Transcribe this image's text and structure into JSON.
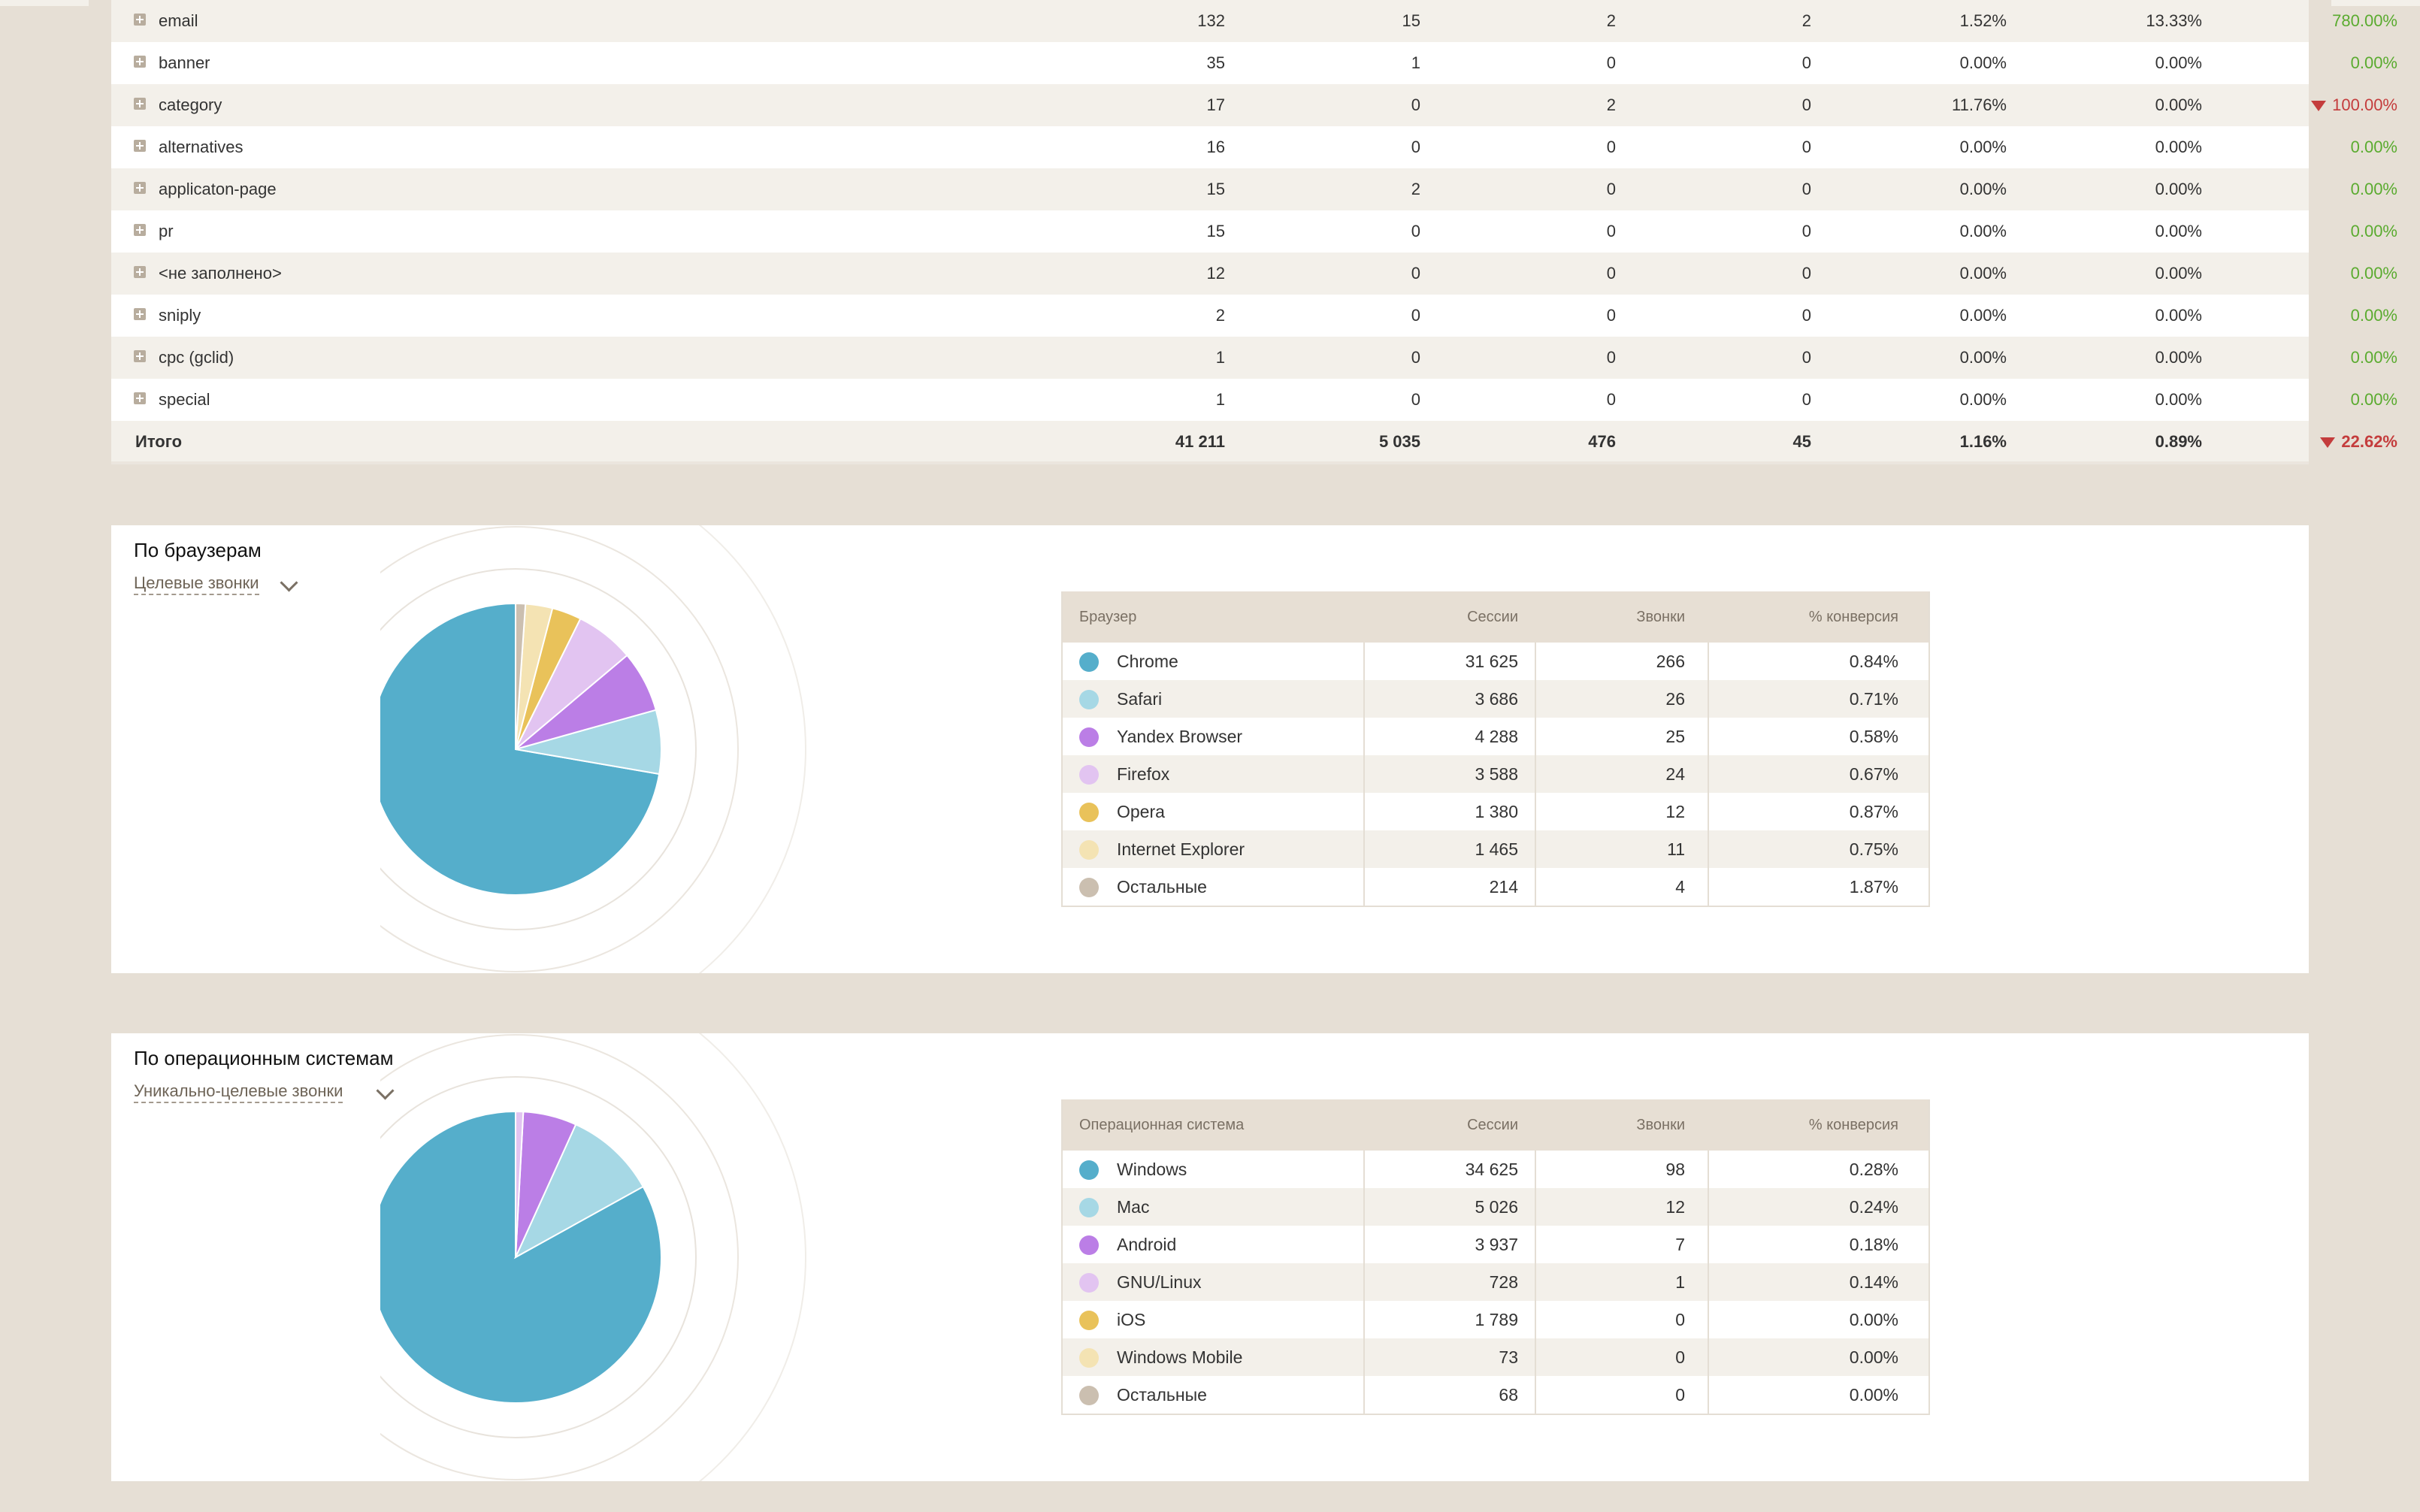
{
  "sources_table": {
    "rows": [
      {
        "name": "email",
        "v1": "132",
        "v2": "15",
        "v3": "2",
        "v4": "2",
        "v5": "1.52%",
        "v6": "13.33%",
        "change": "780.00%",
        "dir": "up"
      },
      {
        "name": "banner",
        "v1": "35",
        "v2": "1",
        "v3": "0",
        "v4": "0",
        "v5": "0.00%",
        "v6": "0.00%",
        "change": "0.00%",
        "dir": "up"
      },
      {
        "name": "category",
        "v1": "17",
        "v2": "0",
        "v3": "2",
        "v4": "0",
        "v5": "11.76%",
        "v6": "0.00%",
        "change": "100.00%",
        "dir": "down"
      },
      {
        "name": "alternatives",
        "v1": "16",
        "v2": "0",
        "v3": "0",
        "v4": "0",
        "v5": "0.00%",
        "v6": "0.00%",
        "change": "0.00%",
        "dir": "up"
      },
      {
        "name": "applicaton-page",
        "v1": "15",
        "v2": "2",
        "v3": "0",
        "v4": "0",
        "v5": "0.00%",
        "v6": "0.00%",
        "change": "0.00%",
        "dir": "up"
      },
      {
        "name": "pr",
        "v1": "15",
        "v2": "0",
        "v3": "0",
        "v4": "0",
        "v5": "0.00%",
        "v6": "0.00%",
        "change": "0.00%",
        "dir": "up"
      },
      {
        "name": "<не заполнено>",
        "v1": "12",
        "v2": "0",
        "v3": "0",
        "v4": "0",
        "v5": "0.00%",
        "v6": "0.00%",
        "change": "0.00%",
        "dir": "up"
      },
      {
        "name": "sniply",
        "v1": "2",
        "v2": "0",
        "v3": "0",
        "v4": "0",
        "v5": "0.00%",
        "v6": "0.00%",
        "change": "0.00%",
        "dir": "up"
      },
      {
        "name": "cpc (gclid)",
        "v1": "1",
        "v2": "0",
        "v3": "0",
        "v4": "0",
        "v5": "0.00%",
        "v6": "0.00%",
        "change": "0.00%",
        "dir": "up"
      },
      {
        "name": "special",
        "v1": "1",
        "v2": "0",
        "v3": "0",
        "v4": "0",
        "v5": "0.00%",
        "v6": "0.00%",
        "change": "0.00%",
        "dir": "up"
      }
    ],
    "total": {
      "name": "Итого",
      "v1": "41 211",
      "v2": "5 035",
      "v3": "476",
      "v4": "45",
      "v5": "1.16%",
      "v6": "0.89%",
      "change": "22.62%",
      "dir": "down"
    }
  },
  "browsers": {
    "title": "По браузерам",
    "selector": "Целевые звонки",
    "headers": {
      "name": "Браузер",
      "sessions": "Сессии",
      "calls": "Звонки",
      "conv": "% конверсия"
    },
    "rows": [
      {
        "label": "Chrome",
        "sessions": "31 625",
        "calls": "266",
        "conv": "0.84%",
        "color": "#55aecb"
      },
      {
        "label": "Safari",
        "sessions": "3 686",
        "calls": "26",
        "conv": "0.71%",
        "color": "#a6d8e5"
      },
      {
        "label": "Yandex Browser",
        "sessions": "4 288",
        "calls": "25",
        "conv": "0.58%",
        "color": "#bb7ee6"
      },
      {
        "label": "Firefox",
        "sessions": "3 588",
        "calls": "24",
        "conv": "0.67%",
        "color": "#e2c4f1"
      },
      {
        "label": "Opera",
        "sessions": "1 380",
        "calls": "12",
        "conv": "0.87%",
        "color": "#e9c25a"
      },
      {
        "label": "Internet Explorer",
        "sessions": "1 465",
        "calls": "11",
        "conv": "0.75%",
        "color": "#f4e3b3"
      },
      {
        "label": "Остальные",
        "sessions": "214",
        "calls": "4",
        "conv": "1.87%",
        "color": "#cbbfb0"
      }
    ],
    "pie_values": [
      266,
      26,
      25,
      24,
      12,
      11,
      4
    ]
  },
  "os": {
    "title": "По операционным системам",
    "selector": "Уникально-целевые звонки",
    "headers": {
      "name": "Операционная система",
      "sessions": "Сессии",
      "calls": "Звонки",
      "conv": "% конверсия"
    },
    "rows": [
      {
        "label": "Windows",
        "sessions": "34 625",
        "calls": "98",
        "conv": "0.28%",
        "color": "#55aecb"
      },
      {
        "label": "Mac",
        "sessions": "5 026",
        "calls": "12",
        "conv": "0.24%",
        "color": "#a6d8e5"
      },
      {
        "label": "Android",
        "sessions": "3 937",
        "calls": "7",
        "conv": "0.18%",
        "color": "#bb7ee6"
      },
      {
        "label": "GNU/Linux",
        "sessions": "728",
        "calls": "1",
        "conv": "0.14%",
        "color": "#e2c4f1"
      },
      {
        "label": "iOS",
        "sessions": "1 789",
        "calls": "0",
        "conv": "0.00%",
        "color": "#e9c25a"
      },
      {
        "label": "Windows Mobile",
        "sessions": "73",
        "calls": "0",
        "conv": "0.00%",
        "color": "#f4e3b3"
      },
      {
        "label": "Остальные",
        "sessions": "68",
        "calls": "0",
        "conv": "0.00%",
        "color": "#cbbfb0"
      }
    ],
    "pie_values": [
      98,
      12,
      7,
      1,
      0,
      0,
      0
    ]
  }
}
